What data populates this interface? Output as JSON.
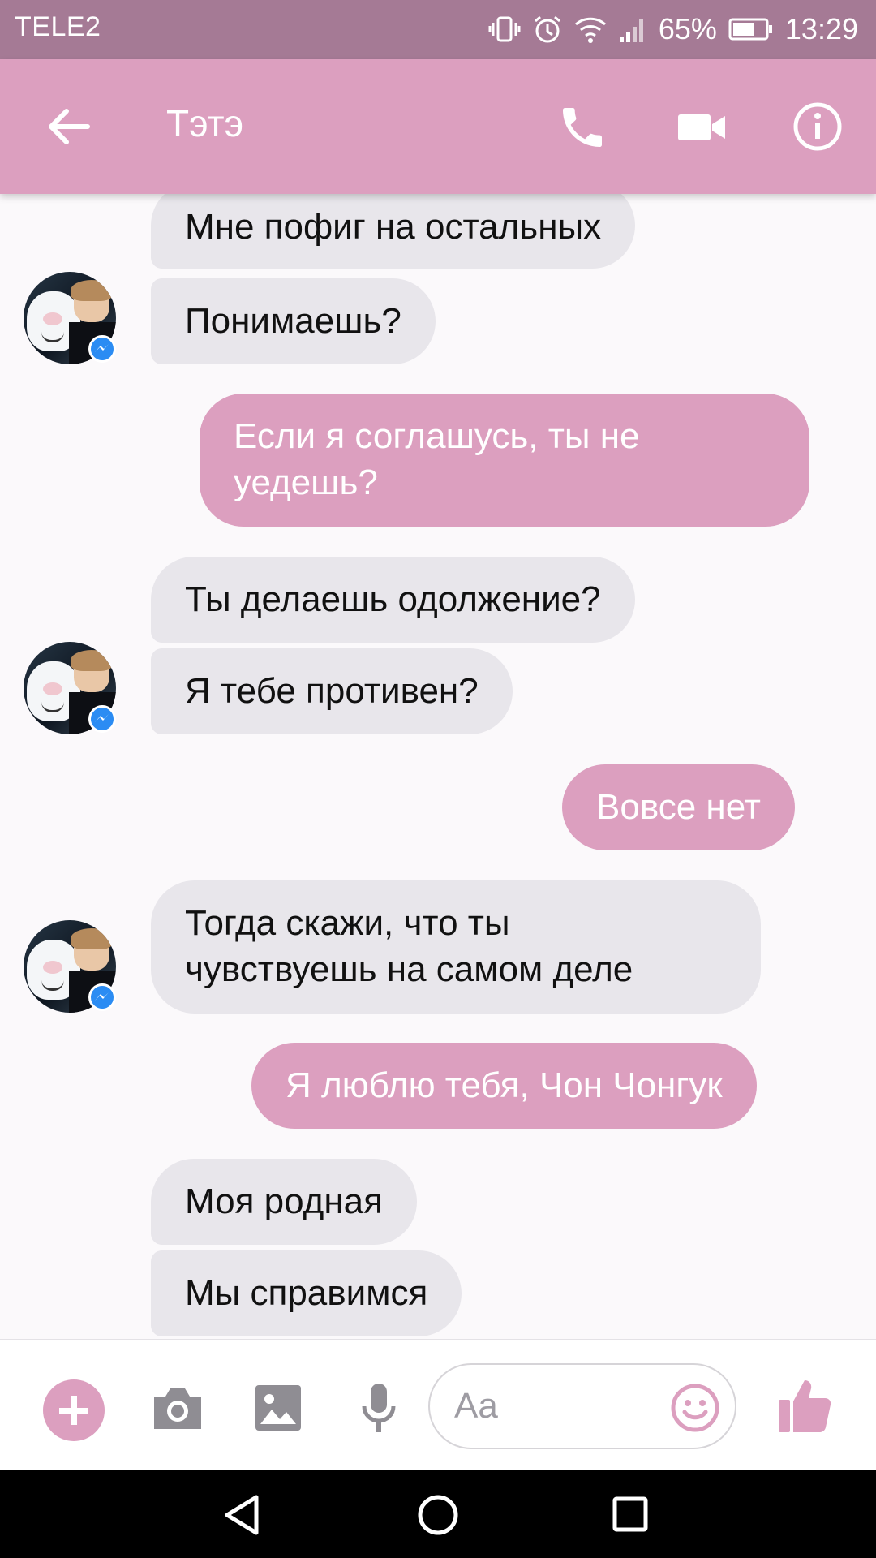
{
  "status_bar": {
    "carrier": "TELE2",
    "battery": "65%",
    "time": "13:29",
    "icons": [
      "vibrate-icon",
      "alarm-icon",
      "wifi-icon",
      "signal-icon",
      "battery-icon"
    ]
  },
  "header": {
    "contact_name": "Тэтэ",
    "icons": [
      "back-arrow-icon",
      "phone-icon",
      "video-camera-icon",
      "info-icon"
    ]
  },
  "messages": [
    {
      "from": "contact",
      "lines": [
        "Мне пофиг на остальных"
      ]
    },
    {
      "from": "contact",
      "lines": [
        "Понимаешь?"
      ]
    },
    {
      "from": "me",
      "lines": [
        "Если я соглашусь, ты не",
        "уедешь?"
      ]
    },
    {
      "from": "contact",
      "lines": [
        "Ты делаешь одолжение?"
      ]
    },
    {
      "from": "contact",
      "lines": [
        "Я тебе противен?"
      ]
    },
    {
      "from": "me",
      "lines": [
        "Вовсе нет"
      ]
    },
    {
      "from": "contact",
      "lines": [
        "Тогда скажи, что ты",
        "чувствуешь на самом деле"
      ]
    },
    {
      "from": "me",
      "lines": [
        "Я люблю тебя, Чон Чонгук"
      ]
    },
    {
      "from": "contact",
      "lines": [
        "Моя родная"
      ]
    },
    {
      "from": "contact",
      "lines": [
        "Мы справимся"
      ]
    }
  ],
  "composer": {
    "placeholder": "Aa",
    "icons": [
      "plus-icon",
      "camera-icon",
      "gallery-icon",
      "microphone-icon",
      "emoji-icon",
      "thumbs-up-icon"
    ]
  },
  "colors": {
    "accent": "#dc9fbf",
    "status_bar": "#a57a95",
    "incoming_bubble": "#e8e6eb",
    "background": "#fbf9fb"
  }
}
